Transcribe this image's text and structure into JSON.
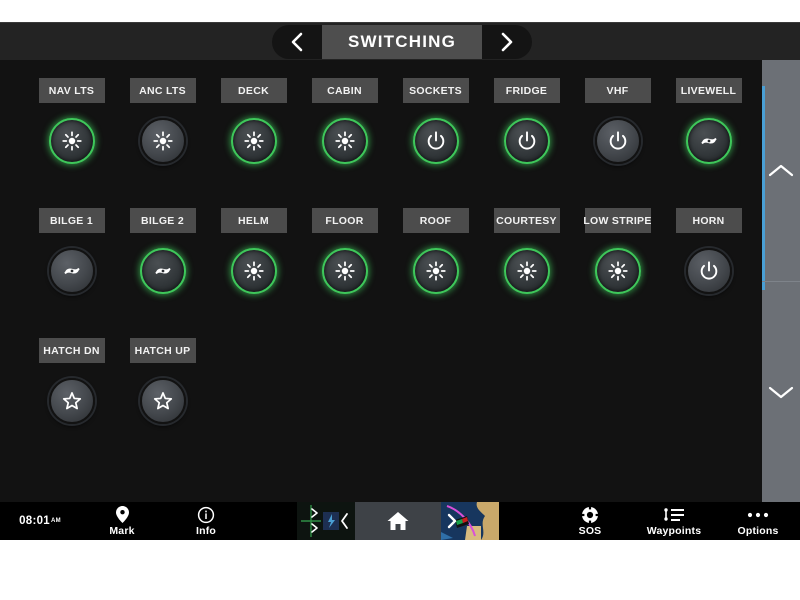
{
  "header": {
    "title": "SWITCHING",
    "prev_arrow": "chevron-left-icon",
    "next_arrow": "chevron-right-icon"
  },
  "colors": {
    "active_ring": "#3ec75a",
    "label_plate": "#4c4c4c",
    "scroll_accent": "#4a9fd4",
    "panel_bg": "#121212",
    "header_bg": "#232323",
    "title_plate": "#4e4e4e"
  },
  "panel": {
    "rows": [
      [
        {
          "label": "NAV LTS",
          "icon": "brightness-icon",
          "state": "on"
        },
        {
          "label": "ANC LTS",
          "icon": "brightness-icon",
          "state": "off"
        },
        {
          "label": "DECK",
          "icon": "brightness-icon",
          "state": "on"
        },
        {
          "label": "CABIN",
          "icon": "brightness-icon",
          "state": "on"
        },
        {
          "label": "SOCKETS",
          "icon": "power-icon",
          "state": "on"
        },
        {
          "label": "FRIDGE",
          "icon": "power-icon",
          "state": "on"
        },
        {
          "label": "VHF",
          "icon": "power-icon",
          "state": "off"
        },
        {
          "label": "LIVEWELL",
          "icon": "pump-icon",
          "state": "on"
        }
      ],
      [
        {
          "label": "BILGE 1",
          "icon": "pump-icon",
          "state": "off"
        },
        {
          "label": "BILGE 2",
          "icon": "pump-icon",
          "state": "on"
        },
        {
          "label": "HELM",
          "icon": "brightness-icon",
          "state": "on"
        },
        {
          "label": "FLOOR",
          "icon": "brightness-icon",
          "state": "on"
        },
        {
          "label": "ROOF",
          "icon": "brightness-icon",
          "state": "on"
        },
        {
          "label": "COURTESY",
          "icon": "brightness-icon",
          "state": "on"
        },
        {
          "label": "LOW STRIPE",
          "icon": "brightness-icon",
          "state": "on"
        },
        {
          "label": "HORN",
          "icon": "power-icon",
          "state": "off"
        }
      ],
      [
        {
          "label": "HATCH DN",
          "icon": "star-icon",
          "state": "off"
        },
        {
          "label": "HATCH UP",
          "icon": "star-icon",
          "state": "off"
        }
      ]
    ]
  },
  "scrollbar": {
    "up_icon": "chevron-up-icon",
    "down_icon": "chevron-down-icon"
  },
  "taskbar": {
    "clock": "08:01",
    "clock_suffix": "AM",
    "items": [
      {
        "label": "Mark",
        "icon": "waypoint-pin-icon"
      },
      {
        "label": "Info",
        "icon": "info-circle-icon"
      },
      {
        "label": "SOS",
        "icon": "lifebuoy-icon"
      },
      {
        "label": "Waypoints",
        "icon": "waypoint-list-icon"
      },
      {
        "label": "Options",
        "icon": "ellipsis-icon"
      }
    ],
    "thumbnails": [
      {
        "name": "route-thumbnail"
      },
      {
        "name": "chart-thumbnail"
      }
    ],
    "home_icon": "home-icon"
  }
}
